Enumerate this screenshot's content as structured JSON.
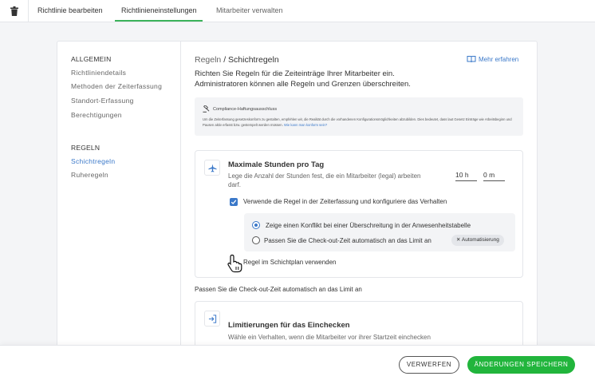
{
  "topbar": {
    "tabs": [
      {
        "label": "Richtlinie bearbeiten"
      },
      {
        "label": "Richtlinieneinstellungen"
      },
      {
        "label": "Mitarbeiter verwalten"
      }
    ],
    "active_tab": "Richtlinieneinstellungen"
  },
  "sidebar": {
    "section_general": "ALLGEMEIN",
    "general_items": [
      "Richtliniendetails",
      "Methoden der Zeiterfassung",
      "Standort-Erfassung",
      "Berechtigungen"
    ],
    "section_rules": "REGELN",
    "rules_items": [
      "Schichtregeln",
      "Ruheregeln"
    ],
    "active_item": "Schichtregeln"
  },
  "main": {
    "breadcrumb_parent": "Regeln",
    "breadcrumb_sep": " / ",
    "breadcrumb_current": "Schichtregeln",
    "learn_more": "Mehr erfahren",
    "intro_line1": "Richten Sie Regeln für die Zeiteinträge Ihrer Mitarbeiter ein.",
    "intro_line2": "Administratoren können alle Regeln und Grenzen überschreiten.",
    "compliance": {
      "title": "Compliance-Haftungsausschluss",
      "text": "Um die Zeiterfassung gesetzeskonform zu gestalten, empfehlen wir, die Realität durch die vorhandenen Konfigurationsmöglichkeiten abzubilden. Dies bedeutet, dass laut Gesetz Einträge wie Arbeitsbeginn und Pausen aktiv erfasst bzw. gestempelt werden müssen.",
      "link": "Wie kann man konform sein?"
    },
    "max_hours": {
      "title": "Maximale Stunden pro Tag",
      "description": "Lege die Anzahl der Stunden fest, die ein Mitarbeiter (legal) arbeiten darf.",
      "hours_value": "10 h",
      "minutes_value": "0 m",
      "checkbox_label": "Verwende die Regel in der Zeiterfassung und konfiguriere das Verhalten",
      "checkbox_checked": true,
      "radio_options": [
        "Zeige einen Konflikt bei einer Überschreitung in der Anwesenheitstabelle",
        "Passen Sie die Check-out-Zeit automatisch an das Limit an"
      ],
      "radio_selected": 0,
      "automation_chip": "Automatisierung",
      "schedule_label": "Regel im Schichtplan verwenden"
    },
    "middle_text": "Passen Sie die Check-out-Zeit automatisch an das Limit an",
    "checkin_limits": {
      "title": "Limitierungen für das Einchecken",
      "description": "Wähle ein Verhalten, wenn die Mitarbeiter vor ihrer Startzeit einchecken"
    }
  },
  "footer": {
    "discard_label": "VERWERFEN",
    "save_label": "ÄNDERUNGEN SPEICHERN"
  },
  "colors": {
    "accent_blue": "#3a78c9",
    "save_green": "#21b53c",
    "tab_underline_green": "#3bb25a"
  },
  "icons": {
    "delete": "trash-icon",
    "learn_more": "book-icon",
    "compliance": "gavel-icon",
    "max_hours": "airplane-icon",
    "checkin": "login-icon",
    "cursor": "hand-pointer-icon"
  }
}
